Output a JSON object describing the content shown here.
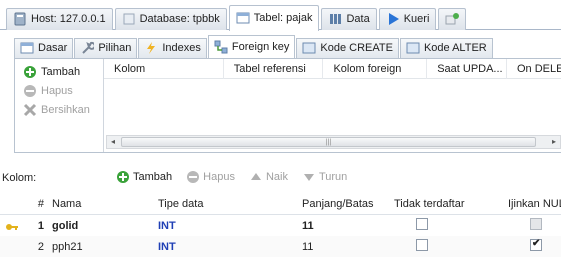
{
  "top_tabs": [
    {
      "label": "Host: 127.0.0.1",
      "icon": "host-icon",
      "active": false
    },
    {
      "label": "Database: tpbbk",
      "icon": "database-icon",
      "active": false
    },
    {
      "label": "Tabel: pajak",
      "icon": "table-icon",
      "active": true
    },
    {
      "label": "Data",
      "icon": "data-icon",
      "active": false
    },
    {
      "label": "Kueri",
      "icon": "run-icon",
      "active": false
    },
    {
      "label": "",
      "icon": "new-query-icon",
      "active": false
    }
  ],
  "sub_tabs": [
    {
      "label": "Dasar",
      "icon": "table-icon",
      "active": false
    },
    {
      "label": "Pilihan",
      "icon": "wrench-icon",
      "active": false
    },
    {
      "label": "Indexes",
      "icon": "lightning-icon",
      "active": false
    },
    {
      "label": "Foreign key",
      "icon": "relation-icon",
      "active": true
    },
    {
      "label": "Kode CREATE",
      "icon": "table-icon",
      "active": false
    },
    {
      "label": "Kode ALTER",
      "icon": "table-icon",
      "active": false
    }
  ],
  "fk_actions": [
    {
      "label": "Tambah",
      "icon": "plus-icon",
      "enabled": true
    },
    {
      "label": "Hapus",
      "icon": "minus-icon",
      "enabled": false
    },
    {
      "label": "Bersihkan",
      "icon": "clear-icon",
      "enabled": false
    }
  ],
  "fk_columns": [
    "Kolom",
    "Tabel referensi",
    "Kolom foreign",
    "Saat UPDA...",
    "On DELE"
  ],
  "kolom_bar": {
    "label": "Kolom:",
    "buttons": [
      {
        "label": "Tambah",
        "icon": "plus-icon",
        "enabled": true
      },
      {
        "label": "Hapus",
        "icon": "minus-icon",
        "enabled": false
      },
      {
        "label": "Naik",
        "icon": "up-icon",
        "enabled": false
      },
      {
        "label": "Turun",
        "icon": "down-icon",
        "enabled": false
      }
    ]
  },
  "columns_table": {
    "headers": [
      "#",
      "Nama",
      "Tipe data",
      "Panjang/Batas",
      "Tidak terdaftar",
      "Ijinkan NULL"
    ],
    "rows": [
      {
        "key": true,
        "num": "1",
        "name": "golid",
        "type": "INT",
        "length": "11",
        "unsigned": false,
        "allow_null": false
      },
      {
        "key": false,
        "num": "2",
        "name": "pph21",
        "type": "INT",
        "length": "11",
        "unsigned": false,
        "allow_null": true
      }
    ]
  },
  "colors": {
    "accent": "#1f3fb5",
    "plus": "#3aa23a",
    "key": "#e3b21b"
  }
}
